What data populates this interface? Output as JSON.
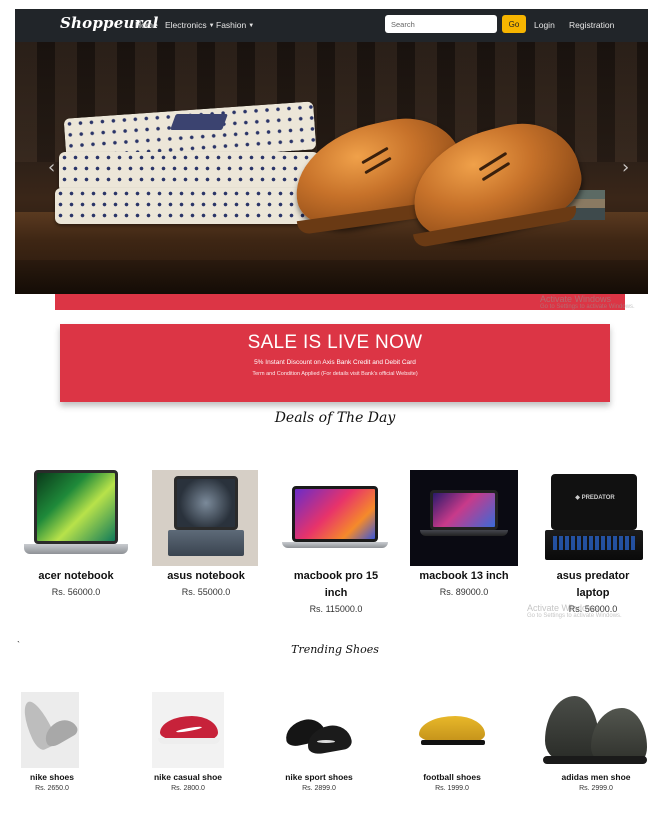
{
  "nav": {
    "brand": "Shoppeural",
    "links": [
      "Home",
      "Electronics",
      "Fashion"
    ],
    "search_placeholder": "Search",
    "go_label": "Go",
    "login": "Login",
    "registration": "Registration"
  },
  "watermark": {
    "line1": "Activate Windows",
    "line2": "Go to Settings to activate Windows."
  },
  "sale": {
    "title": "SALE IS LIVE NOW",
    "subtitle": "5% Instant Discount on Axis Bank Credit and Debit Card",
    "terms": "Term and Condition Applied (For details visit Bank's official Website)"
  },
  "deals": {
    "title": "Deals of The Day",
    "products": [
      {
        "name": "acer notebook",
        "price": "Rs. 56000.0"
      },
      {
        "name": "asus notebook",
        "price": "Rs. 55000.0"
      },
      {
        "name": "macbook pro 15 inch",
        "price": "Rs. 115000.0"
      },
      {
        "name": "macbook 13 inch",
        "price": "Rs. 89000.0"
      },
      {
        "name": "asus predator laptop",
        "price": "Rs. 56000.0"
      }
    ]
  },
  "trending": {
    "title": "Trending Shoes",
    "products": [
      {
        "name": "nike shoes",
        "price": "Rs. 2650.0"
      },
      {
        "name": "nike casual shoe",
        "price": "Rs. 2800.0"
      },
      {
        "name": "nike sport shoes",
        "price": "Rs. 2899.0"
      },
      {
        "name": "football shoes",
        "price": "Rs. 1999.0"
      },
      {
        "name": "adidas men shoe",
        "price": "Rs. 2999.0"
      }
    ]
  },
  "colors": {
    "navbar": "#212529",
    "accent_yellow": "#f7b500",
    "sale_red": "#dc3545"
  }
}
